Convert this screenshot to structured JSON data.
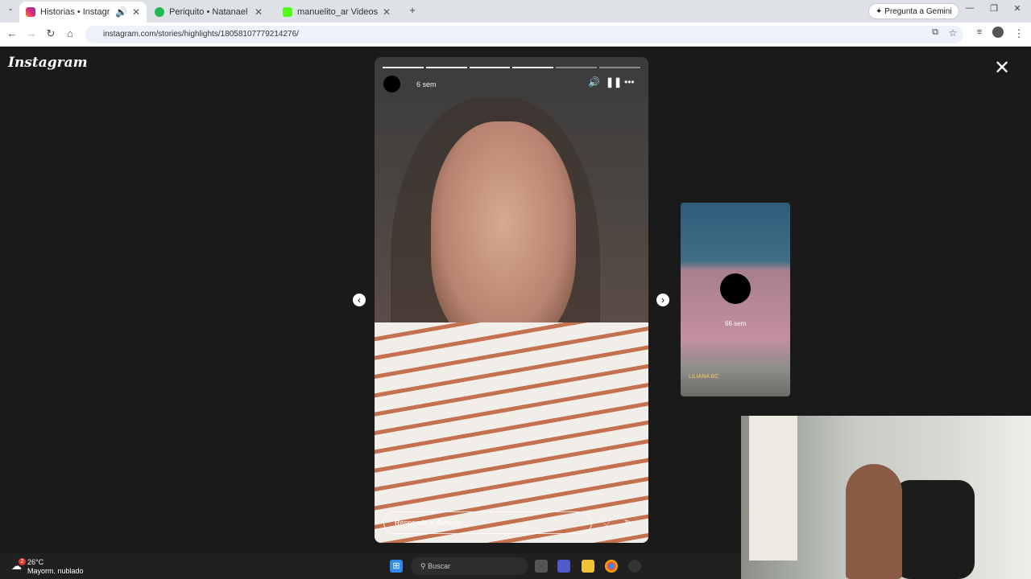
{
  "browser": {
    "tabs": [
      {
        "title": "Historias • Instagram",
        "active": true
      },
      {
        "title": "Periquito • Natanael Cano",
        "active": false
      },
      {
        "title": "manuelito_ar Videos - Watch Cl",
        "active": false
      }
    ],
    "new_tab": "+",
    "url": "instagram.com/stories/highlights/18058107779214276/",
    "gemini_label": "Pregunta a Gemini"
  },
  "instagram": {
    "logo": "Instagram",
    "story": {
      "time": "6 sem",
      "reply_placeholder": "Responde a darwdgo...",
      "progress_total": 6,
      "progress_done": 4
    },
    "next_preview": {
      "time": "66 sem",
      "caption": "LILIANA BC"
    }
  },
  "taskbar": {
    "temperature": "26°C",
    "weather": "Mayorm. nublado",
    "weather_badge": "2",
    "search_placeholder": "Buscar"
  },
  "icons": {
    "close": "close-icon",
    "volume": "volume-icon",
    "pause": "pause-icon",
    "more": "more-icon",
    "heart": "heart-icon",
    "send": "send-icon",
    "prev": "chevron-left-icon",
    "next": "chevron-right-icon"
  }
}
